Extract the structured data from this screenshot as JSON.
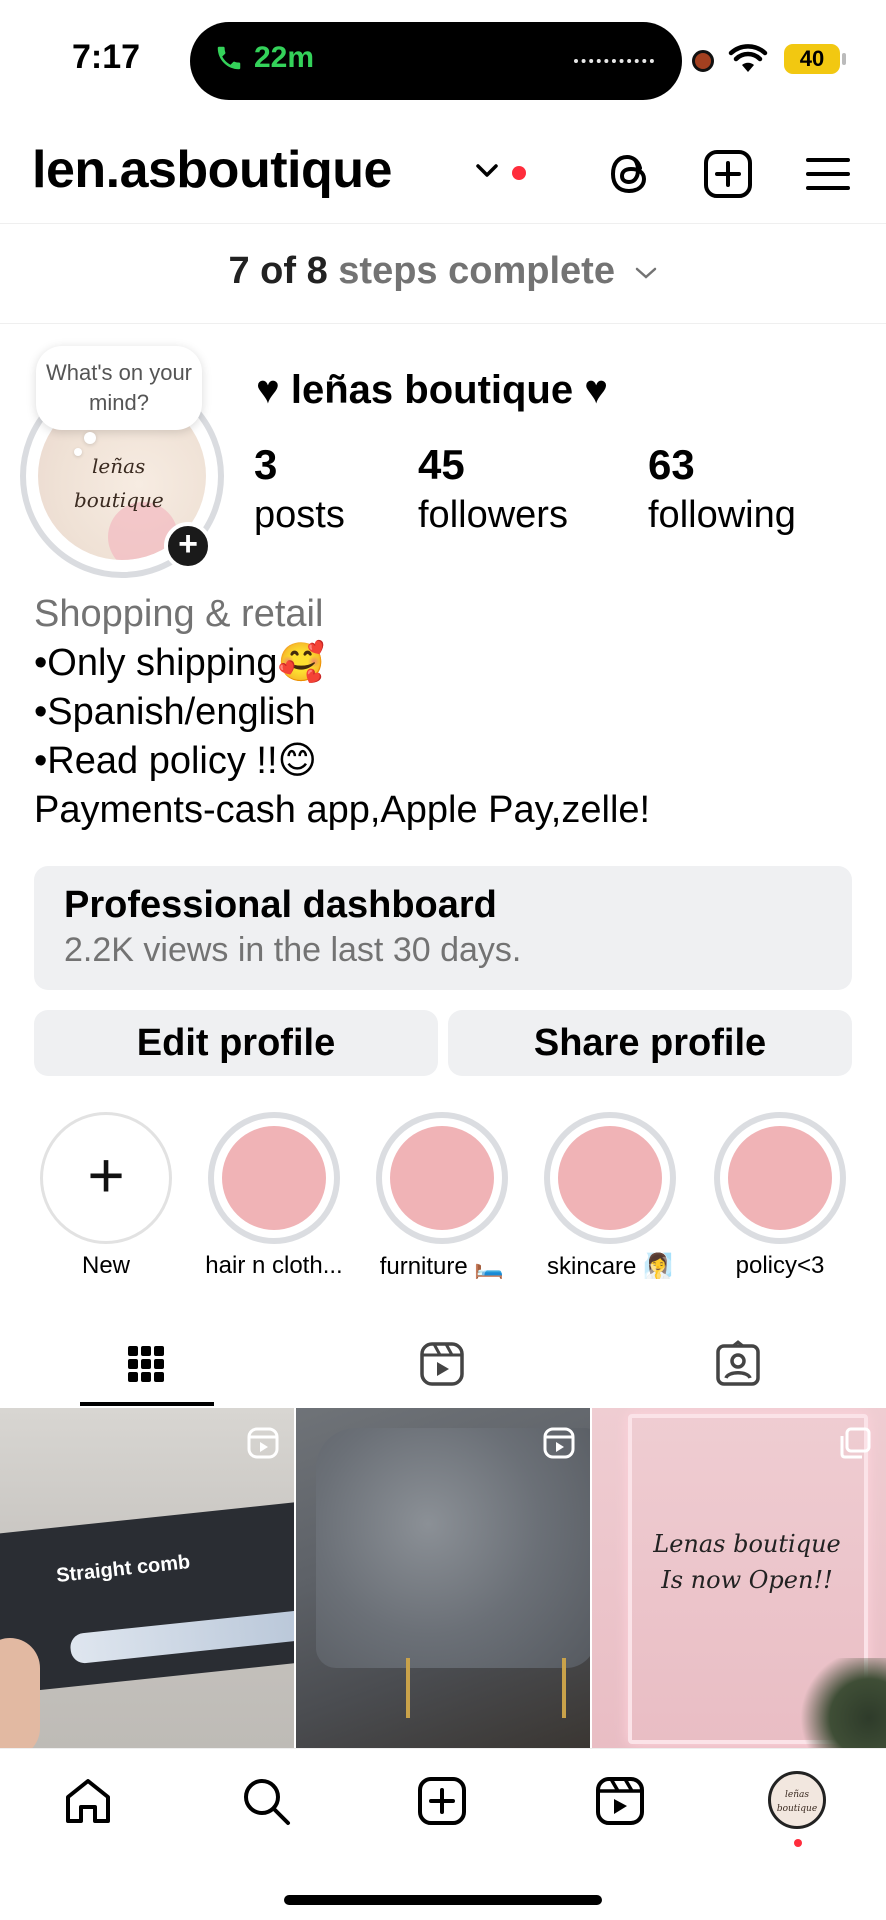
{
  "status_bar": {
    "time": "7:17",
    "call_duration": "22m",
    "battery": "40",
    "call_color": "#34d25a",
    "battery_color": "#f2c811"
  },
  "header": {
    "username": "len.asboutique",
    "icons": [
      "chevron-down-icon",
      "threads-icon",
      "create-plus-icon",
      "menu-icon"
    ]
  },
  "steps": {
    "strong": "7 of 8",
    "muted": "steps complete"
  },
  "profile": {
    "note_bubble": "What's on your mind?",
    "avatar_text_1": "leñas",
    "avatar_text_2": "boutique",
    "display_name": "♥ leñas boutique ♥",
    "stats": [
      {
        "number": "3",
        "label": "posts"
      },
      {
        "number": "45",
        "label": "followers"
      },
      {
        "number": "63",
        "label": "following"
      }
    ]
  },
  "bio": {
    "category": "Shopping & retail",
    "lines": [
      "•Only shipping🥰",
      "•Spanish/english",
      "•Read policy !!😊",
      "Payments-cash app,Apple Pay,zelle!"
    ]
  },
  "dashboard": {
    "title": "Professional dashboard",
    "subtitle": "2.2K views in the last 30 days."
  },
  "buttons": {
    "edit": "Edit profile",
    "share": "Share profile"
  },
  "highlights": [
    {
      "label": "New",
      "is_new": true
    },
    {
      "label": "hair n cloth..."
    },
    {
      "label": "furniture 🛏️"
    },
    {
      "label": "skincare 🧖‍♀️"
    },
    {
      "label": "policy<3"
    }
  ],
  "tabs": [
    "grid-icon",
    "reels-icon",
    "tagged-icon"
  ],
  "posts": [
    {
      "text": "Straight comb",
      "type": "reel"
    },
    {
      "text": "",
      "type": "reel"
    },
    {
      "text_line1": "Lenas boutique",
      "text_line2": "Is now Open!!",
      "type": "carousel"
    }
  ],
  "bottom_nav": [
    "home-icon",
    "search-icon",
    "create-icon",
    "reels-icon",
    "profile-avatar"
  ],
  "colors": {
    "accent_red": "#ff2d3c",
    "muted_text": "#737373",
    "button_bg": "#eff0f2",
    "highlight_pink": "#f0b3b6"
  }
}
